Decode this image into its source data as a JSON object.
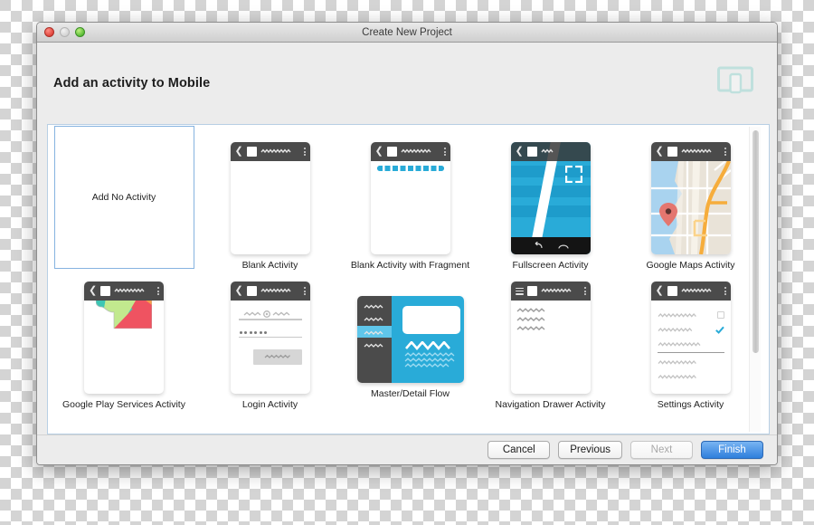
{
  "window": {
    "title": "Create New Project",
    "traffic_lights": [
      "close-button",
      "minimize-button",
      "zoom-button"
    ]
  },
  "header": {
    "title": "Add an activity to Mobile",
    "device_icon": "tablet-and-phone-icon"
  },
  "colors": {
    "accent_blue": "#29abd8",
    "selection_border": "#86b3e0",
    "appbar_dark": "#4b4b4b",
    "drawer_dark": "#333333",
    "default_button": "#2f7fdc",
    "map_water": "#a9d3ef",
    "map_land": "#e9e3d8",
    "map_road": "#f6ad3c",
    "pin_red": "#e4766f"
  },
  "gallery": {
    "rows": [
      [
        {
          "label": "Add No Activity",
          "kind": "no-activity",
          "selected": true
        },
        {
          "label": "Blank Activity",
          "kind": "blank"
        },
        {
          "label": "Blank Activity with Fragment",
          "kind": "fragment"
        },
        {
          "label": "Fullscreen Activity",
          "kind": "fullscreen"
        },
        {
          "label": "Google Maps Activity",
          "kind": "maps"
        }
      ],
      [
        {
          "label": "Google Play Services Activity",
          "kind": "play-services"
        },
        {
          "label": "Login Activity",
          "kind": "login"
        },
        {
          "label": "Master/Detail Flow",
          "kind": "master-detail"
        },
        {
          "label": "Navigation Drawer Activity",
          "kind": "nav-drawer"
        },
        {
          "label": "Settings Activity",
          "kind": "settings"
        }
      ]
    ]
  },
  "scrollbar": {
    "orientation": "vertical",
    "thumb_position_percent": 0
  },
  "footer": {
    "buttons": [
      {
        "label": "Cancel",
        "state": "enabled"
      },
      {
        "label": "Previous",
        "state": "enabled"
      },
      {
        "label": "Next",
        "state": "disabled"
      },
      {
        "label": "Finish",
        "state": "default"
      }
    ]
  }
}
